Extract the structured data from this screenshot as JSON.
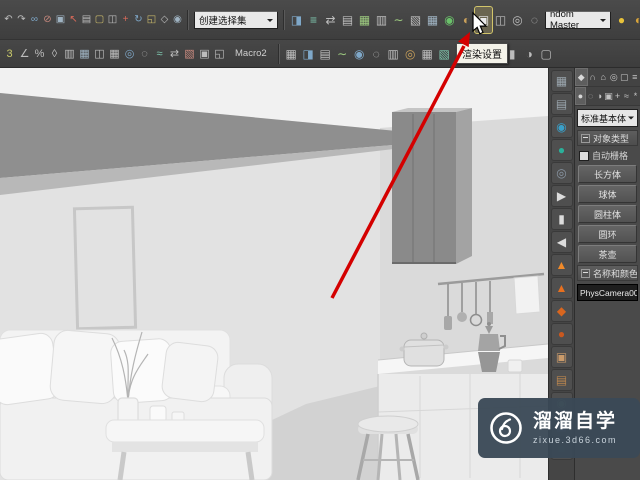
{
  "toolbar1": {
    "selection_set_value": "创建选择集",
    "render_preset_value": "ndom Master",
    "left_icons": [
      {
        "name": "undo-icon",
        "glyph": "↶",
        "fg": "#bdbdbd"
      },
      {
        "name": "redo-icon",
        "glyph": "↷",
        "fg": "#bdbdbd"
      },
      {
        "name": "select-and-link-icon",
        "glyph": "∞",
        "fg": "#7fa8c9"
      },
      {
        "name": "unlink-selection-icon",
        "glyph": "⊘",
        "fg": "#c98a7f"
      },
      {
        "name": "bind-to-spacewarp-icon",
        "glyph": "▣",
        "fg": "#9fb3c2"
      },
      {
        "name": "select-object-icon",
        "glyph": "↖",
        "fg": "#d96a5a"
      },
      {
        "name": "select-by-name-icon",
        "glyph": "▤",
        "fg": "#bdbdbd"
      },
      {
        "name": "rectangular-region-icon",
        "glyph": "▢",
        "fg": "#c9b96a"
      },
      {
        "name": "window-crossing-icon",
        "glyph": "◫",
        "fg": "#bdbdbd"
      },
      {
        "name": "select-and-move-icon",
        "glyph": "+",
        "fg": "#d96a5a"
      },
      {
        "name": "select-and-rotate-icon",
        "glyph": "↻",
        "fg": "#7fa8c9"
      },
      {
        "name": "select-and-scale-icon",
        "glyph": "◱",
        "fg": "#c9b96a"
      },
      {
        "name": "reference-coordinate-icon",
        "glyph": "◇",
        "fg": "#bdbdbd"
      },
      {
        "name": "use-pivot-center-icon",
        "glyph": "◉",
        "fg": "#9fb3c2"
      }
    ],
    "mid_icons": [
      {
        "name": "mirror-icon",
        "glyph": "◨",
        "fg": "#7fa8c9"
      },
      {
        "name": "align-icon",
        "glyph": "≡",
        "fg": "#7fc9b0"
      },
      {
        "name": "quick-align-icon",
        "glyph": "⇄",
        "fg": "#bdbdbd"
      },
      {
        "name": "layer-manager-icon",
        "glyph": "▤",
        "fg": "#bdbdbd"
      },
      {
        "name": "ribbon-toggle-icon",
        "glyph": "▦",
        "fg": "#9cc97f"
      },
      {
        "name": "scene-explorer-icon",
        "glyph": "▥",
        "fg": "#bdbdbd"
      },
      {
        "name": "curve-editor-icon",
        "glyph": "∼",
        "fg": "#9cc97f"
      },
      {
        "name": "dope-sheet-icon",
        "glyph": "▧",
        "fg": "#bdbdbd"
      },
      {
        "name": "schematic-view-icon",
        "glyph": "▦",
        "fg": "#9fb3c2"
      },
      {
        "name": "material-editor-icon",
        "glyph": "◉",
        "fg": "#6ac06a"
      },
      {
        "name": "compact-material-editor-icon",
        "glyph": "◐",
        "fg": "#c9a05a"
      },
      {
        "name": "render-setup-icon",
        "glyph": "▣",
        "fg": "#eaeaea",
        "hl": true
      },
      {
        "name": "rendered-frame-window-icon",
        "glyph": "◫",
        "fg": "#bdbdbd"
      },
      {
        "name": "environment-dialog-icon",
        "glyph": "◎",
        "fg": "#bdbdbd"
      },
      {
        "name": "effects-dialog-icon",
        "glyph": "◌",
        "fg": "#bdbdbd"
      }
    ],
    "right_icons": [
      {
        "name": "render-production-teapot-icon",
        "glyph": "●",
        "fg": "#e8c23a"
      },
      {
        "name": "render-iterative-teapot-icon",
        "glyph": "◐",
        "fg": "#d8a43a"
      }
    ]
  },
  "toolbar2": {
    "macro_label": "Macro2",
    "left_icons": [
      {
        "name": "snaps-toggle-icon",
        "glyph": "3",
        "fg": "#c9c96a"
      },
      {
        "name": "angle-snap-icon",
        "glyph": "∠",
        "fg": "#bdbdbd"
      },
      {
        "name": "percent-snap-icon",
        "glyph": "%",
        "fg": "#bdbdbd"
      },
      {
        "name": "spinner-snap-icon",
        "glyph": "◊",
        "fg": "#bdbdbd"
      },
      {
        "name": "named-selections-icon",
        "glyph": "▥",
        "fg": "#bdbdbd"
      },
      {
        "name": "tool-icon",
        "glyph": "▦",
        "fg": "#9fb3c2"
      },
      {
        "name": "tool-icon",
        "glyph": "◫",
        "fg": "#bdbdbd"
      },
      {
        "name": "tool-icon",
        "glyph": "▦",
        "fg": "#bdbdbd"
      },
      {
        "name": "tool-icon",
        "glyph": "◎",
        "fg": "#7fa8c9"
      },
      {
        "name": "tool-icon",
        "glyph": "◌",
        "fg": "#bdbdbd"
      },
      {
        "name": "tool-icon",
        "glyph": "≈",
        "fg": "#7fc9b0"
      },
      {
        "name": "tool-icon",
        "glyph": "⇄",
        "fg": "#bdbdbd"
      },
      {
        "name": "tool-icon",
        "glyph": "▧",
        "fg": "#c98a7f"
      },
      {
        "name": "tool-icon",
        "glyph": "▣",
        "fg": "#bdbdbd"
      },
      {
        "name": "tool-icon",
        "glyph": "◱",
        "fg": "#bdbdbd"
      }
    ],
    "right_icons": [
      {
        "name": "tool-icon",
        "glyph": "▦",
        "fg": "#bdbdbd"
      },
      {
        "name": "tool-icon",
        "glyph": "◨",
        "fg": "#7fa8c9"
      },
      {
        "name": "tool-icon",
        "glyph": "▤",
        "fg": "#bdbdbd"
      },
      {
        "name": "tool-icon",
        "glyph": "∼",
        "fg": "#9cc97f"
      },
      {
        "name": "tool-icon",
        "glyph": "◉",
        "fg": "#7fa8c9"
      },
      {
        "name": "tool-icon",
        "glyph": "◌",
        "fg": "#bdbdbd"
      },
      {
        "name": "tool-icon",
        "glyph": "▥",
        "fg": "#bdbdbd"
      },
      {
        "name": "tool-icon",
        "glyph": "◎",
        "fg": "#c9a05a"
      },
      {
        "name": "tool-icon",
        "glyph": "▦",
        "fg": "#bdbdbd"
      },
      {
        "name": "tool-icon",
        "glyph": "▧",
        "fg": "#7fc9b0"
      },
      {
        "name": "tool-icon",
        "glyph": "◫",
        "fg": "#bdbdbd"
      },
      {
        "name": "tool-icon",
        "glyph": "●",
        "fg": "#8f8f8f"
      },
      {
        "name": "tool-icon",
        "glyph": "◆",
        "fg": "#9fb3c2"
      },
      {
        "name": "tool-icon",
        "glyph": "▮",
        "fg": "#bdbdbd"
      },
      {
        "name": "tool-icon",
        "glyph": "◑",
        "fg": "#bdbdbd"
      },
      {
        "name": "tool-icon",
        "glyph": "▢",
        "fg": "#bdbdbd"
      }
    ]
  },
  "tooltip": {
    "text": "渲染设置"
  },
  "side_toolbar": {
    "icons": [
      {
        "name": "grid-tool-icon",
        "glyph": "▦",
        "fg": "#9aa5ad"
      },
      {
        "name": "snap-grid-tool-icon",
        "glyph": "▤",
        "fg": "#9aa5ad"
      },
      {
        "name": "sphere-tool-icon",
        "glyph": "◉",
        "fg": "#3aa0c9"
      },
      {
        "name": "geosphere-tool-icon",
        "glyph": "●",
        "fg": "#2bb09a"
      },
      {
        "name": "camera-tool-icon",
        "glyph": "◎",
        "fg": "#8a97a5"
      },
      {
        "name": "play-animation-icon",
        "glyph": "▶",
        "fg": "#dcdcdc"
      },
      {
        "name": "pause-animation-icon",
        "glyph": "▮",
        "fg": "#dcdcdc"
      },
      {
        "name": "stop-animation-icon",
        "glyph": "◀",
        "fg": "#dcdcdc"
      },
      {
        "name": "fire-effect-icon",
        "glyph": "▲",
        "fg": "#f08a2a"
      },
      {
        "name": "flame-tool-icon",
        "glyph": "▲",
        "fg": "#e8701f"
      },
      {
        "name": "heat-tool-icon",
        "glyph": "◆",
        "fg": "#d9661f"
      },
      {
        "name": "burn-tool-icon",
        "glyph": "●",
        "fg": "#c9581f"
      },
      {
        "name": "wood-material-icon",
        "glyph": "▣",
        "fg": "#c99a6a"
      },
      {
        "name": "clay-material-icon",
        "glyph": "▤",
        "fg": "#b9854f"
      },
      {
        "name": "plant-tool-icon",
        "glyph": "◉",
        "fg": "#7fa87f"
      },
      {
        "name": "water-tool-icon",
        "glyph": "▦",
        "fg": "#6a8ac9"
      },
      {
        "name": "dark-tool-icon",
        "glyph": "■",
        "fg": "#5a6570"
      }
    ]
  },
  "command_panel": {
    "tabs": [
      {
        "name": "tab-create",
        "glyph": "◆",
        "fg": "#d8d8d8",
        "active": true
      },
      {
        "name": "tab-modify",
        "glyph": "∩",
        "fg": "#c4c4c4"
      },
      {
        "name": "tab-hierarchy",
        "glyph": "⌂",
        "fg": "#c4c4c4"
      },
      {
        "name": "tab-motion",
        "glyph": "◎",
        "fg": "#c4c4c4"
      },
      {
        "name": "tab-display",
        "glyph": "▢",
        "fg": "#c4c4c4"
      },
      {
        "name": "tab-utilities",
        "glyph": "≡",
        "fg": "#c4c4c4"
      }
    ],
    "categories": [
      {
        "name": "category-geometry",
        "glyph": "●",
        "fg": "#d8d8d8",
        "active": true
      },
      {
        "name": "category-shapes",
        "glyph": "◌",
        "fg": "#c4c4c4"
      },
      {
        "name": "category-lights",
        "glyph": "◑",
        "fg": "#c4c4c4"
      },
      {
        "name": "category-cameras",
        "glyph": "▣",
        "fg": "#c4c4c4"
      },
      {
        "name": "category-helpers",
        "glyph": "+",
        "fg": "#c4c4c4"
      },
      {
        "name": "category-spacewarps",
        "glyph": "≈",
        "fg": "#c4c4c4"
      },
      {
        "name": "category-systems",
        "glyph": "*",
        "fg": "#c4c4c4"
      }
    ],
    "primitive_dropdown": "标准基本体",
    "object_type_rollout": "对象类型",
    "autogrid_label": "自动栅格",
    "primitive_buttons": [
      "长方体",
      "球体",
      "圆柱体",
      "圆环",
      "茶壶"
    ],
    "name_rollout": "名称和颜色",
    "name_value": "PhysCamera00"
  },
  "annotation": {
    "arrow_color": "#d40000"
  },
  "watermark": {
    "brand": "溜溜自学",
    "url": "zixue.3d66.com"
  }
}
